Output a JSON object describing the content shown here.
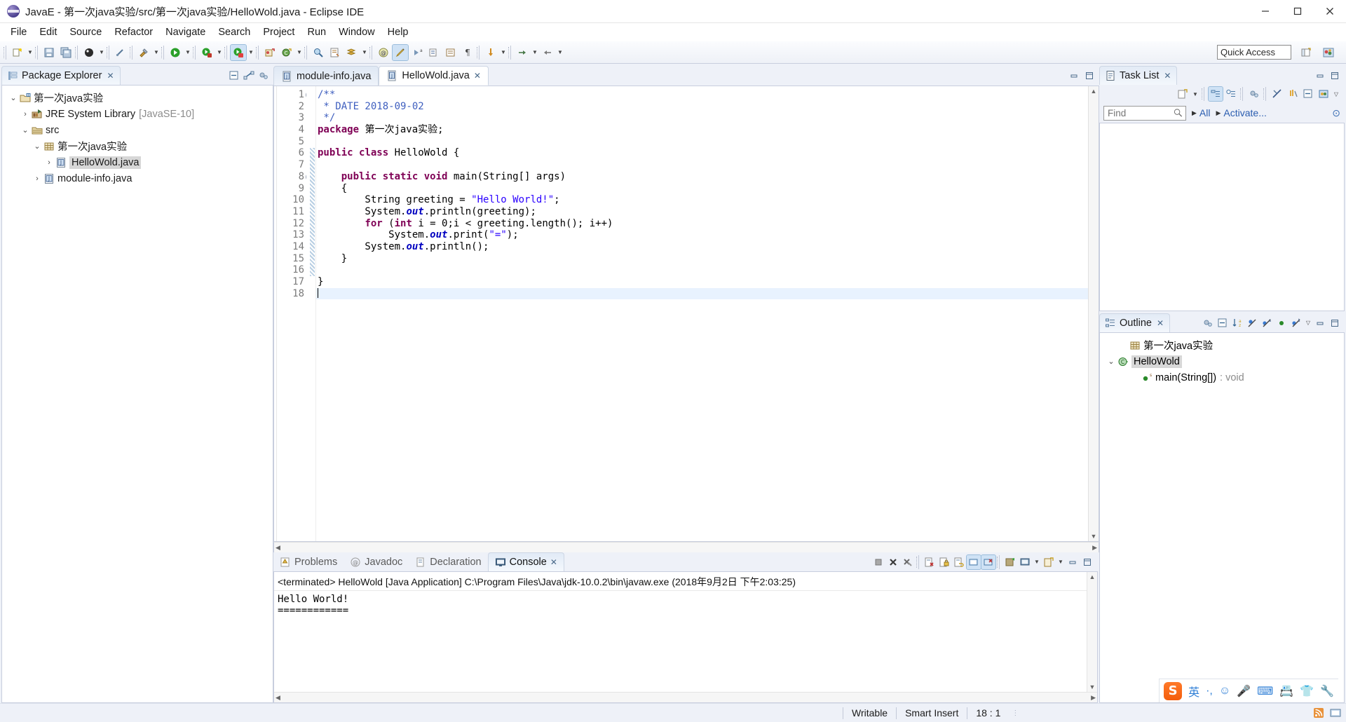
{
  "window": {
    "title": "JavaE - 第一次java实验/src/第一次java实验/HelloWold.java - Eclipse IDE",
    "app_icon": "eclipse-icon",
    "minimize": "minimize-icon",
    "maximize": "maximize-icon",
    "close": "close-icon"
  },
  "menubar": {
    "items": [
      "File",
      "Edit",
      "Source",
      "Refactor",
      "Navigate",
      "Search",
      "Project",
      "Run",
      "Window",
      "Help"
    ]
  },
  "toolbar": {
    "quick_access_placeholder": "Quick Access",
    "groups": [
      [
        "new-wizard-icon",
        "new-wizard-dropdown"
      ],
      [
        "save-icon",
        "save-all-icon"
      ],
      [
        "debug-icon",
        "debug-dropdown"
      ],
      [
        "link-icon"
      ],
      [
        "build-icon",
        "build-dropdown"
      ],
      [
        "run-icon",
        "run-dropdown"
      ],
      [
        "run-last-icon",
        "run-last-dropdown"
      ],
      [
        "coverage-icon",
        "coverage-dropdown"
      ],
      [
        "new-java-project-icon",
        "new-class-icon",
        "new-class-dropdown"
      ],
      [
        "search-icon",
        "open-type-icon",
        "open-task-icon",
        "open-task-dropdown"
      ],
      [
        "annotation-icon",
        "pencil-icon",
        "next-annotation-icon",
        "previous-annotation-icon"
      ],
      [
        "toggle-mark-icon",
        "toggle-block-icon",
        "pilcrow-icon"
      ],
      [
        "back-icon",
        "back-dropdown",
        "forward-icon",
        "forward-dropdown"
      ]
    ],
    "right_icons": [
      "open-perspective-icon",
      "java-perspective-icon"
    ]
  },
  "package_explorer": {
    "title": "Package Explorer",
    "close_label": "✕",
    "tools": [
      "collapse-all-icon",
      "link-with-editor-icon",
      "view-menu-icon"
    ],
    "tree": [
      {
        "depth": 0,
        "twisty": "expanded",
        "icon": "java-project-icon",
        "label": "第一次java实验",
        "sub": "",
        "selected": false
      },
      {
        "depth": 1,
        "twisty": "collapsed",
        "icon": "jre-library-icon",
        "label": "JRE System Library",
        "sub": "[JavaSE-10]",
        "selected": false
      },
      {
        "depth": 1,
        "twisty": "expanded",
        "icon": "source-folder-icon",
        "label": "src",
        "sub": "",
        "selected": false
      },
      {
        "depth": 2,
        "twisty": "expanded",
        "icon": "package-icon",
        "label": "第一次java实验",
        "sub": "",
        "selected": false
      },
      {
        "depth": 3,
        "twisty": "collapsed",
        "icon": "java-file-icon",
        "label": "HelloWold.java",
        "sub": "",
        "selected": true
      },
      {
        "depth": 2,
        "twisty": "collapsed",
        "icon": "java-file-icon",
        "label": "module-info.java",
        "sub": "",
        "selected": false
      }
    ]
  },
  "editor": {
    "tabs": [
      {
        "label": "module-info.java",
        "icon": "java-file-icon",
        "active": false,
        "closable": false
      },
      {
        "label": "HelloWold.java",
        "icon": "java-file-icon",
        "active": true,
        "closable": true
      }
    ],
    "status_minimize": "minimize-icon",
    "status_maximize": "maximize-icon",
    "first_line": 1,
    "current_line": 18,
    "lines": [
      {
        "n": 1,
        "fold": true,
        "bar": false,
        "current": false,
        "tokens": [
          {
            "t": "cm",
            "v": "/**"
          }
        ]
      },
      {
        "n": 2,
        "fold": false,
        "bar": false,
        "current": false,
        "tokens": [
          {
            "t": "cm",
            "v": " * DATE 2018-09-02"
          }
        ]
      },
      {
        "n": 3,
        "fold": false,
        "bar": false,
        "current": false,
        "tokens": [
          {
            "t": "cm",
            "v": " */"
          }
        ]
      },
      {
        "n": 4,
        "fold": false,
        "bar": false,
        "current": false,
        "tokens": [
          {
            "t": "kw",
            "v": "package"
          },
          {
            "t": "pl",
            "v": " 第一次java实验;"
          }
        ]
      },
      {
        "n": 5,
        "fold": false,
        "bar": false,
        "current": false,
        "tokens": [
          {
            "t": "pl",
            "v": ""
          }
        ]
      },
      {
        "n": 6,
        "fold": false,
        "bar": true,
        "current": false,
        "tokens": [
          {
            "t": "kw",
            "v": "public class"
          },
          {
            "t": "pl",
            "v": " HelloWold {"
          }
        ]
      },
      {
        "n": 7,
        "fold": false,
        "bar": true,
        "current": false,
        "tokens": [
          {
            "t": "pl",
            "v": ""
          }
        ]
      },
      {
        "n": 8,
        "fold": true,
        "bar": true,
        "current": false,
        "tokens": [
          {
            "t": "pl",
            "v": "    "
          },
          {
            "t": "kw",
            "v": "public static void"
          },
          {
            "t": "pl",
            "v": " main(String[] args)"
          }
        ]
      },
      {
        "n": 9,
        "fold": false,
        "bar": true,
        "current": false,
        "tokens": [
          {
            "t": "pl",
            "v": "    {"
          }
        ]
      },
      {
        "n": 10,
        "fold": false,
        "bar": true,
        "current": false,
        "tokens": [
          {
            "t": "pl",
            "v": "        String greeting = "
          },
          {
            "t": "st",
            "v": "\"Hello World!\""
          },
          {
            "t": "pl",
            "v": ";"
          }
        ]
      },
      {
        "n": 11,
        "fold": false,
        "bar": true,
        "current": false,
        "tokens": [
          {
            "t": "pl",
            "v": "        System."
          },
          {
            "t": "fld",
            "v": "out"
          },
          {
            "t": "pl",
            "v": ".println(greeting);"
          }
        ]
      },
      {
        "n": 12,
        "fold": false,
        "bar": true,
        "current": false,
        "tokens": [
          {
            "t": "pl",
            "v": "        "
          },
          {
            "t": "kw",
            "v": "for"
          },
          {
            "t": "pl",
            "v": " ("
          },
          {
            "t": "kw",
            "v": "int"
          },
          {
            "t": "pl",
            "v": " i = 0;i < greeting.length(); i++)"
          }
        ]
      },
      {
        "n": 13,
        "fold": false,
        "bar": true,
        "current": false,
        "tokens": [
          {
            "t": "pl",
            "v": "            System."
          },
          {
            "t": "fld",
            "v": "out"
          },
          {
            "t": "pl",
            "v": ".print("
          },
          {
            "t": "st",
            "v": "\"=\""
          },
          {
            "t": "pl",
            "v": ");"
          }
        ]
      },
      {
        "n": 14,
        "fold": false,
        "bar": true,
        "current": false,
        "tokens": [
          {
            "t": "pl",
            "v": "        System."
          },
          {
            "t": "fld",
            "v": "out"
          },
          {
            "t": "pl",
            "v": ".println();"
          }
        ]
      },
      {
        "n": 15,
        "fold": false,
        "bar": true,
        "current": false,
        "tokens": [
          {
            "t": "pl",
            "v": "    }"
          }
        ]
      },
      {
        "n": 16,
        "fold": false,
        "bar": true,
        "current": false,
        "tokens": [
          {
            "t": "pl",
            "v": ""
          }
        ]
      },
      {
        "n": 17,
        "fold": false,
        "bar": false,
        "current": false,
        "tokens": [
          {
            "t": "pl",
            "v": "}"
          }
        ]
      },
      {
        "n": 18,
        "fold": false,
        "bar": false,
        "current": true,
        "tokens": [
          {
            "t": "pl",
            "v": ""
          }
        ]
      }
    ]
  },
  "task_list": {
    "title": "Task List",
    "close_label": "✕",
    "tools": [
      "new-task-icon",
      "new-task-dropdown",
      "categorized-mode-icon",
      "scheduled-mode-icon",
      "synchronize-icon",
      "focus-icon",
      "filter-icon",
      "collapse-all-icon",
      "restore-icon",
      "view-menu-icon"
    ],
    "minimize": "minimize-icon",
    "maximize": "maximize-icon",
    "find_placeholder": "Find",
    "find_value": "",
    "search_icon": "search-icon",
    "all_label": "All",
    "activate_label": "Activate...",
    "help_icon": "help-icon",
    "items": []
  },
  "outline": {
    "title": "Outline",
    "close_label": "✕",
    "tools": [
      "focus-icon",
      "collapse-all-icon",
      "sort-icon",
      "hide-fields-icon",
      "hide-static-icon",
      "hide-nonpublic-icon",
      "hide-local-icon",
      "view-menu-icon"
    ],
    "minimize": "minimize-icon",
    "maximize": "maximize-icon",
    "tree": [
      {
        "depth": 1,
        "twisty": "none",
        "icon": "package-icon",
        "label": "第一次java实验",
        "sub": "",
        "selected": false
      },
      {
        "depth": 0,
        "twisty": "expanded",
        "icon": "class-icon",
        "label": "HelloWold",
        "sub": "",
        "selected": true
      },
      {
        "depth": 2,
        "twisty": "none",
        "icon": "method-icon",
        "label": "main(String[])",
        "sub": ": void",
        "selected": false
      }
    ]
  },
  "bottom": {
    "tabs": [
      {
        "label": "Problems",
        "icon": "problems-icon",
        "active": false,
        "closable": false
      },
      {
        "label": "Javadoc",
        "icon": "javadoc-icon",
        "active": false,
        "closable": false
      },
      {
        "label": "Declaration",
        "icon": "declaration-icon",
        "active": false,
        "closable": false
      },
      {
        "label": "Console",
        "icon": "console-icon",
        "active": true,
        "closable": true
      }
    ],
    "tools": [
      "terminate-icon",
      "remove-launch-icon",
      "remove-all-launches-icon",
      "clear-console-icon",
      "scroll-lock-icon",
      "word-wrap-icon",
      "show-console-on-output-icon",
      "show-console-on-error-icon",
      "pin-console-icon",
      "display-console-icon",
      "display-console-dropdown",
      "open-console-icon",
      "open-console-dropdown",
      "minimize-icon",
      "maximize-icon"
    ],
    "console_header": "<terminated> HelloWold [Java Application] C:\\Program Files\\Java\\jdk-10.0.2\\bin\\javaw.exe (2018年9月2日 下午2:03:25)",
    "console_output": "Hello World!\n============"
  },
  "statusbar": {
    "writable": "Writable",
    "insert_mode": "Smart Insert",
    "position": "18 : 1",
    "right_icons": [
      "feed-icon",
      "tray-icon"
    ]
  },
  "ime": {
    "logo": "S",
    "items": [
      "英",
      "·,",
      "☺",
      "🎤",
      "⌨",
      "📇",
      "👕",
      "🔧"
    ],
    "names": [
      "sogou-logo",
      "language-mode",
      "punctuation-mode",
      "emoji-icon",
      "voice-input-icon",
      "soft-keyboard-icon",
      "screenshot-icon",
      "skin-icon",
      "tools-icon"
    ]
  }
}
